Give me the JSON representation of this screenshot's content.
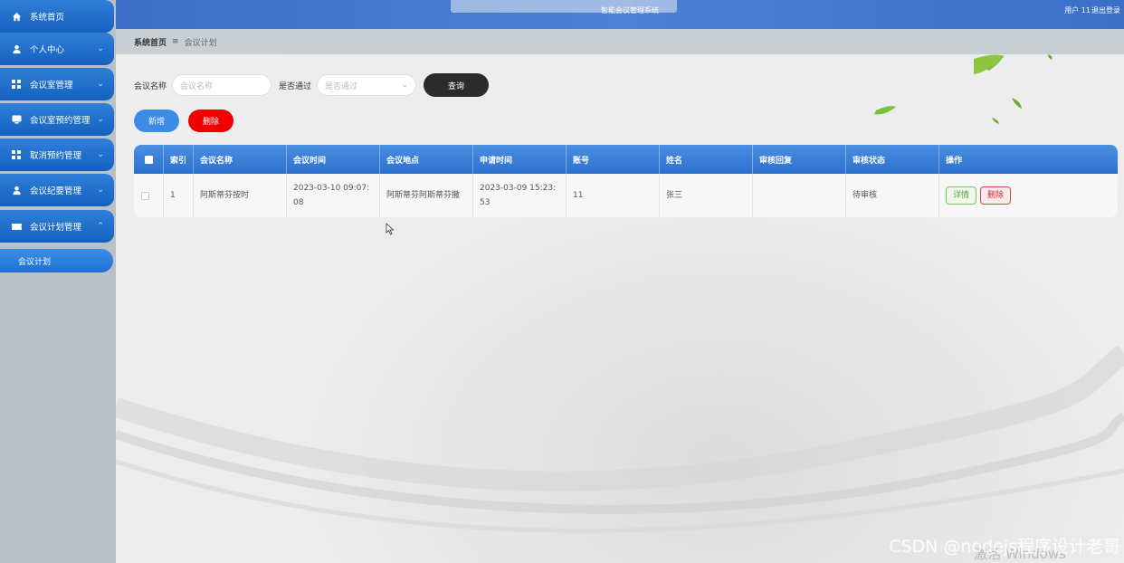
{
  "app": {
    "title": "智能会议管理系统",
    "user_text": "用户 11",
    "logout_label": "退出登录"
  },
  "sidebar": {
    "items": [
      {
        "label": "系统首页",
        "icon": "home-icon"
      },
      {
        "label": "个人中心",
        "icon": "user-icon"
      },
      {
        "label": "会议室管理",
        "icon": "grid-icon"
      },
      {
        "label": "会议室预约管理",
        "icon": "monitor-icon"
      },
      {
        "label": "取消预约管理",
        "icon": "grid-icon"
      },
      {
        "label": "会议纪要管理",
        "icon": "user-icon"
      },
      {
        "label": "会议计划管理",
        "icon": "ticket-icon"
      }
    ],
    "active_sub": "会议计划"
  },
  "breadcrumb": {
    "home": "系统首页",
    "separator": "≡",
    "current": "会议计划"
  },
  "search": {
    "name_label": "会议名称",
    "name_placeholder": "会议名称",
    "pass_label": "是否通过",
    "pass_placeholder": "是否通过",
    "query_label": "查询"
  },
  "actions": {
    "add_label": "新增",
    "delete_label": "删除"
  },
  "table": {
    "headers": [
      "索引",
      "会议名称",
      "会议时间",
      "会议地点",
      "申请时间",
      "账号",
      "姓名",
      "审核回复",
      "审核状态",
      "操作"
    ],
    "rows": [
      {
        "index": "1",
        "name": "阿斯蒂芬按时",
        "meeting_time": "2023-03-10 09:07:08",
        "location": "阿斯蒂芬阿斯蒂芬撒",
        "apply_time": "2023-03-09 15:23:53",
        "account": "11",
        "person": "张三",
        "reply": "",
        "status": "待审核",
        "detail_label": "详情",
        "delete_label": "删除"
      }
    ]
  },
  "watermark": "CSDN @nodejs程序设计老哥",
  "windows_mark": "激活 Windows"
}
